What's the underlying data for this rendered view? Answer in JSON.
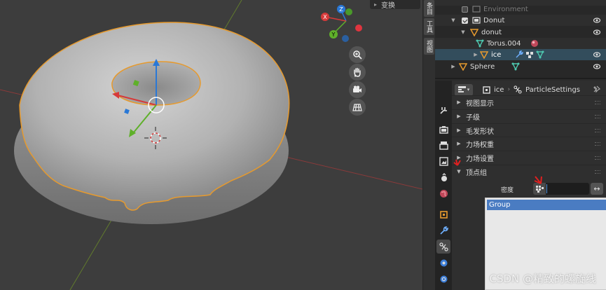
{
  "viewport": {
    "header_tab_label": "变换",
    "gizmo_axes": {
      "z": "Z",
      "y": "Y",
      "x": "X"
    },
    "nav_buttons": [
      "zoom-icon",
      "hand-icon",
      "camera-icon",
      "grid-icon"
    ]
  },
  "side_tabs": [
    "条目",
    "工具",
    "视图"
  ],
  "outliner": {
    "rows": [
      {
        "label": "Environment",
        "dim": true
      },
      {
        "label": "Donut"
      },
      {
        "label": "donut"
      },
      {
        "label": "Torus.004"
      },
      {
        "label": "ice",
        "selected": true
      },
      {
        "label": "Sphere"
      }
    ]
  },
  "properties": {
    "breadcrumb": {
      "object": "ice",
      "settings": "ParticleSettings"
    },
    "panels": [
      {
        "label": "视图显示",
        "expanded": false
      },
      {
        "label": "子级",
        "expanded": false
      },
      {
        "label": "毛发形状",
        "expanded": false
      },
      {
        "label": "力场权重",
        "expanded": false
      },
      {
        "label": "力场设置",
        "expanded": false
      },
      {
        "label": "顶点组",
        "expanded": true
      }
    ],
    "vertex_group": {
      "density_label": "密度",
      "value": "",
      "invert_icon": "↔",
      "dropdown_items": [
        "Group"
      ]
    }
  },
  "watermark": "CSDN @精致的螺旋线",
  "colors": {
    "viewport_bg": "#3d3d3d",
    "selection_outline": "#e69a2e",
    "accent_blue": "#4a7cc2",
    "outliner_selected": "#334d5c"
  }
}
